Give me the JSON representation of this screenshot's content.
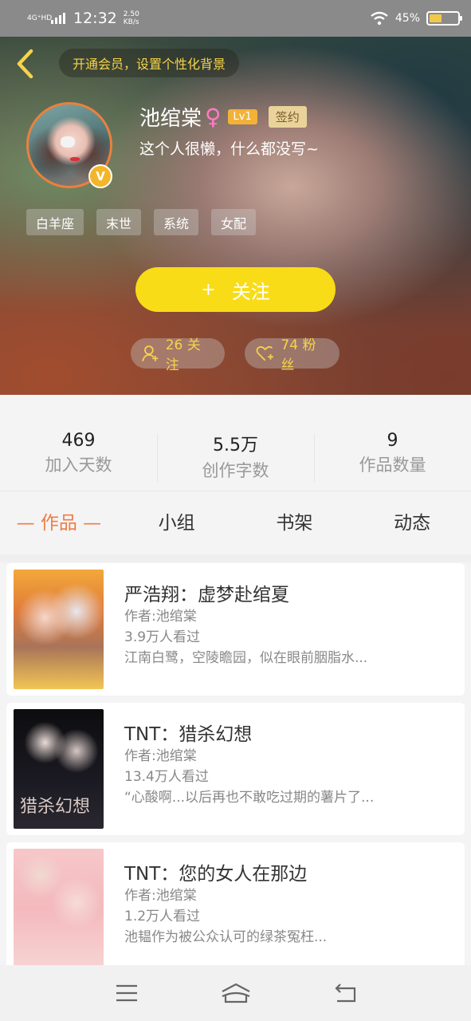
{
  "status_bar": {
    "network": "4G⁺HD",
    "time": "12:32",
    "speed_value": "2.50",
    "speed_unit": "KB/s",
    "battery": "45%",
    "battery_level": 0.45
  },
  "header": {
    "vip_banner": "开通会员，设置个性化背景",
    "username": "池绾棠",
    "gender_symbol": "♀",
    "level": "Lv1",
    "signed": "签约",
    "verified_badge": "V",
    "bio": "这个人很懒，什么都没写~",
    "tags": [
      "白羊座",
      "末世",
      "系统",
      "女配"
    ],
    "follow_plus": "+",
    "follow_label": "关注",
    "following_count": "26 关注",
    "fans_count": "74 粉丝"
  },
  "stats": [
    {
      "value": "469",
      "label": "加入天数"
    },
    {
      "value": "5.5万",
      "label": "创作字数"
    },
    {
      "value": "9",
      "label": "作品数量"
    }
  ],
  "tabs": [
    "— 作品 —",
    "小组",
    "书架",
    "动态"
  ],
  "books": [
    {
      "title": "严浩翔：虚梦赴绾夏",
      "author": "作者:池绾棠",
      "views": "3.9万人看过",
      "desc": "江南白鹭，空陵瞻园，似在眼前胭脂水..."
    },
    {
      "title": "TNT：猎杀幻想",
      "author": "作者:池绾棠",
      "views": "13.4万人看过",
      "desc": "“心酸啊...以后再也不敢吃过期的薯片了...",
      "cover_text": "猎杀幻想"
    },
    {
      "title": "TNT：您的女人在那边",
      "author": "作者:池绾棠",
      "views": "1.2万人看过",
      "desc": "池韫作为被公众认可的绿茶冤枉..."
    }
  ],
  "icons": {
    "back": "chevron-left-icon",
    "user": "user-plus-icon",
    "heart": "heart-plus-icon",
    "menu": "menu-icon",
    "home": "home-icon",
    "back_nav": "return-icon"
  },
  "colors": {
    "accent": "#ef7b45",
    "follow_button": "#f8dc18",
    "highlight_text": "#f6d34a"
  }
}
